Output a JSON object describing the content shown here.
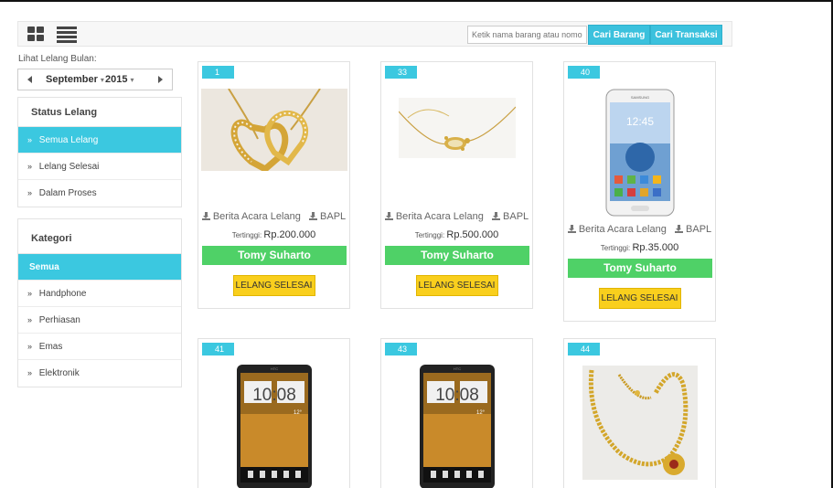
{
  "toolbar": {
    "search_placeholder": "Ketik nama barang atau nomor",
    "search_goods_label": "Cari Barang",
    "search_transaction_label": "Cari Transaksi"
  },
  "sidebar": {
    "month_label": "Lihat Lelang Bulan:",
    "month": "September",
    "year": "2015",
    "status_title": "Status Lelang",
    "status_items": [
      {
        "label": "Semua Lelang",
        "active": true
      },
      {
        "label": "Lelang Selesai",
        "active": false
      },
      {
        "label": "Dalam Proses",
        "active": false
      }
    ],
    "category_title": "Kategori",
    "category_all": "Semua",
    "category_items": [
      "Handphone",
      "Perhiasan",
      "Emas",
      "Elektronik"
    ]
  },
  "cards": [
    {
      "id": "1",
      "report_label": "Berita Acara Lelang",
      "bapl_label": "BAPL",
      "highest_label": "Tertinggi:",
      "highest_value": "Rp.200.000",
      "winner": "Tomy Suharto",
      "status": "LELANG SELESAI",
      "image": "gold-heart-necklace"
    },
    {
      "id": "33",
      "report_label": "Berita Acara Lelang",
      "bapl_label": "BAPL",
      "highest_label": "Tertinggi:",
      "highest_value": "Rp.500.000",
      "winner": "Tomy Suharto",
      "status": "LELANG SELESAI",
      "image": "gold-turtle-necklace"
    },
    {
      "id": "40",
      "report_label": "Berita Acara Lelang",
      "bapl_label": "BAPL",
      "highest_label": "Tertinggi:",
      "highest_value": "Rp.35.000",
      "winner": "Tomy Suharto",
      "status": "LELANG SELESAI",
      "image": "samsung-phone"
    },
    {
      "id": "41",
      "image": "htc-phone"
    },
    {
      "id": "43",
      "image": "htc-phone"
    },
    {
      "id": "44",
      "image": "gold-chain-necklace"
    }
  ],
  "phone_screens": {
    "samsung_brand": "SAMSUNG",
    "samsung_time": "12:45",
    "htc_brand": "HTC",
    "htc_time": "10:08",
    "htc_temp": "12°"
  },
  "colors": {
    "accent": "#3bc8e0",
    "winner": "#4fd167",
    "status": "#f9cf1d"
  }
}
